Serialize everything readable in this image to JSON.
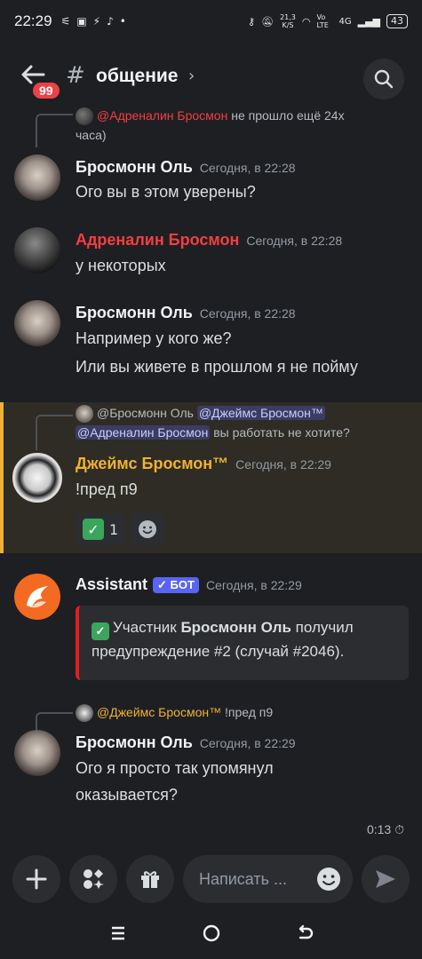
{
  "status_bar": {
    "time": "22:29",
    "net_speed": "21,3",
    "net_unit": "K/S",
    "volte": "Vo LTE",
    "network": "4G",
    "battery": "43"
  },
  "header": {
    "unread_count": "99",
    "channel_hash": "#",
    "channel_name": "общение",
    "chevron": "›"
  },
  "messages": [
    {
      "reply_author": "@Адреналин Бросмон",
      "reply_text_1": "не прошло ещё 24х",
      "reply_text_2": "часа)",
      "author": "Бросмонн Оль",
      "timestamp": "Сегодня, в 22:28",
      "text": "Ого вы в этом уверены?"
    },
    {
      "author": "Адреналин Бросмон",
      "timestamp": "Сегодня, в 22:28",
      "text": "у некоторых"
    },
    {
      "author": "Бросмонн Оль",
      "timestamp": "Сегодня, в 22:28",
      "text_1": "Например у кого же?",
      "text_2": "Или вы живете в прошлом я не пойму"
    },
    {
      "reply_author": "@Бросмонн Оль",
      "reply_mention_1": "@Джеймс Бросмон™",
      "reply_mention_2": "@Адреналин Бросмон",
      "reply_text": "вы работать не хотите?",
      "author": "Джеймс Бросмон™",
      "timestamp": "Сегодня, в 22:29",
      "text": "!пред п9",
      "reaction_count": "1"
    },
    {
      "author": "Assistant",
      "bot_tag": "✓ БОТ",
      "timestamp": "Сегодня, в 22:29",
      "embed_prefix": "Участник",
      "embed_name": "Бросмонн Оль",
      "embed_suffix_1": "получил",
      "embed_line_2": "предупреждение #2 (случай #2046)."
    },
    {
      "reply_author": "@Джеймс Бросмон™",
      "reply_text": "!пред п9",
      "author": "Бросмонн Оль",
      "timestamp": "Сегодня, в 22:29",
      "text_1": "Ого я просто так упомянул",
      "text_2": "оказывается?"
    }
  ],
  "voice_timer": "0:13",
  "input": {
    "placeholder": "Написать ..."
  },
  "colors": {
    "background": "#1e1f22",
    "accent_red": "#f23f43",
    "accent_yellow": "#f0b232",
    "bot_blue": "#5865f2",
    "embed_border": "#e01e22",
    "badge_red": "#ed4245"
  },
  "icons": [
    "back-arrow-icon",
    "search-icon",
    "plus-icon",
    "apps-icon",
    "gift-icon",
    "emoji-icon",
    "send-icon",
    "menu-icon",
    "home-icon",
    "back-icon",
    "smile-icon",
    "timer-icon"
  ]
}
